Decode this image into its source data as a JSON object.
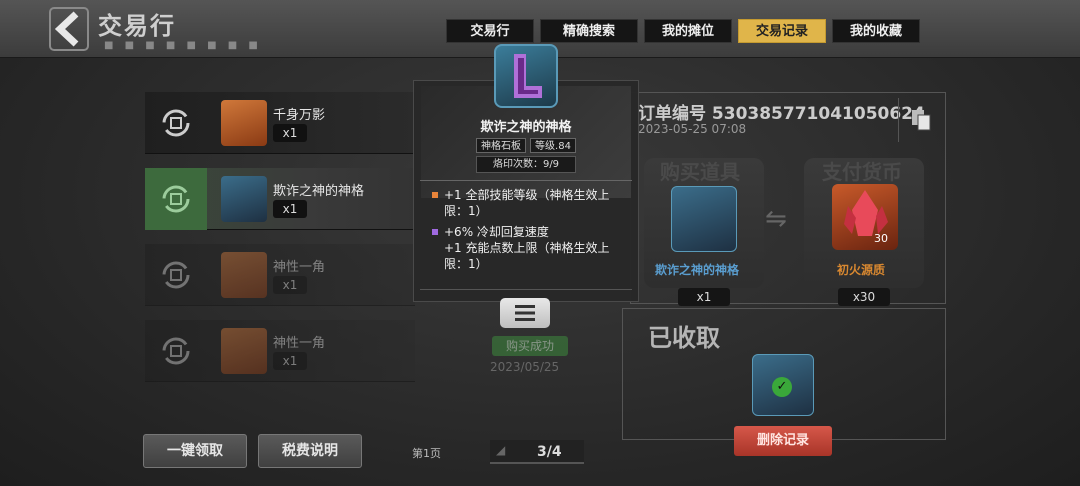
{
  "header": {
    "title": "交易行",
    "dots": "■ ■ ■ ■ ■ ■ ■ ■"
  },
  "tabs": [
    {
      "label": "交易行",
      "active": false
    },
    {
      "label": "精确搜索",
      "active": false
    },
    {
      "label": "我的摊位",
      "active": false
    },
    {
      "label": "交易记录",
      "active": true
    },
    {
      "label": "我的收藏",
      "active": false
    }
  ],
  "list": [
    {
      "name": "千身万影",
      "qty": "x1",
      "state": "normal"
    },
    {
      "name": "欺诈之神的神格",
      "qty": "x1",
      "state": "selected"
    },
    {
      "name": "神性一角",
      "qty": "x1",
      "state": "dim"
    },
    {
      "name": "神性一角",
      "qty": "x1",
      "state": "dim"
    }
  ],
  "tooltip": {
    "name": "欺诈之神的神格",
    "tag_type": "神格石板",
    "tag_level": "等级.84",
    "imprint": "烙印次数：9/9",
    "line1": "+1 全部技能等级（神格生效上限：1）",
    "line2a": "+6% 冷却回复速度",
    "line2b": "+1 充能点数上限（神格生效上限：1）",
    "bullet1_color": "#e8843a",
    "bullet2_color": "#a06ae0"
  },
  "list_status": {
    "badge": "购买成功",
    "date": "2023/05/25"
  },
  "order": {
    "number_label": "订单编号 530385771041050624",
    "datetime": "2023-05-25 07:08",
    "buy_label": "购买道具",
    "pay_label": "支付货币",
    "buy_item_name": "欺诈之神的神格",
    "buy_qty": "x1",
    "pay_item_name": "初火源质",
    "pay_qty": "x30",
    "pay_icon_num": "30",
    "collected_label": "已收取",
    "delete_label": "删除记录"
  },
  "footer": {
    "claim_all": "一键领取",
    "tax_info": "税费说明",
    "page_label": "第1页",
    "page_count": "3/4"
  },
  "colors": {
    "active_tab": "#e0b54a",
    "delete_button": "#c8463a",
    "success_green": "#3d8a3d"
  }
}
